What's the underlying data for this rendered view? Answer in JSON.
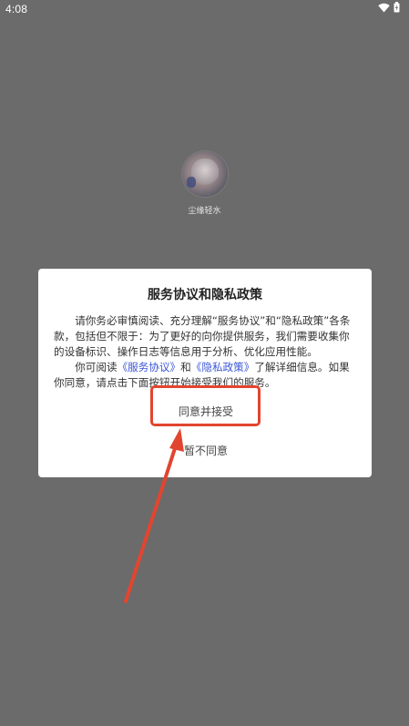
{
  "status_bar": {
    "time": "4:08",
    "icons": [
      "wifi-icon",
      "battery-icon"
    ]
  },
  "splash": {
    "app_name": "尘缘轻水"
  },
  "dialog": {
    "title": "服务协议和隐私政策",
    "paragraph1": "请你务必审慎阅读、充分理解“服务协议”和“隐私政策”各条款，包括但不限于：为了更好的向你提供服务，我们需要收集你的设备标识、操作日志等信息用于分析、优化应用性能。",
    "paragraph2_prefix": "你可阅读",
    "service_link": "《服务协议》",
    "and_text": "和",
    "privacy_link": "《隐私政策》",
    "paragraph2_suffix": "了解详细信息。如果你同意，请点击下面按钮开始接受我们的服务。",
    "agree_label": "同意并接受",
    "decline_label": "暂不同意"
  },
  "colors": {
    "background": "#6b6b6b",
    "link": "#3a55d8",
    "annotation": "#e2452f"
  }
}
